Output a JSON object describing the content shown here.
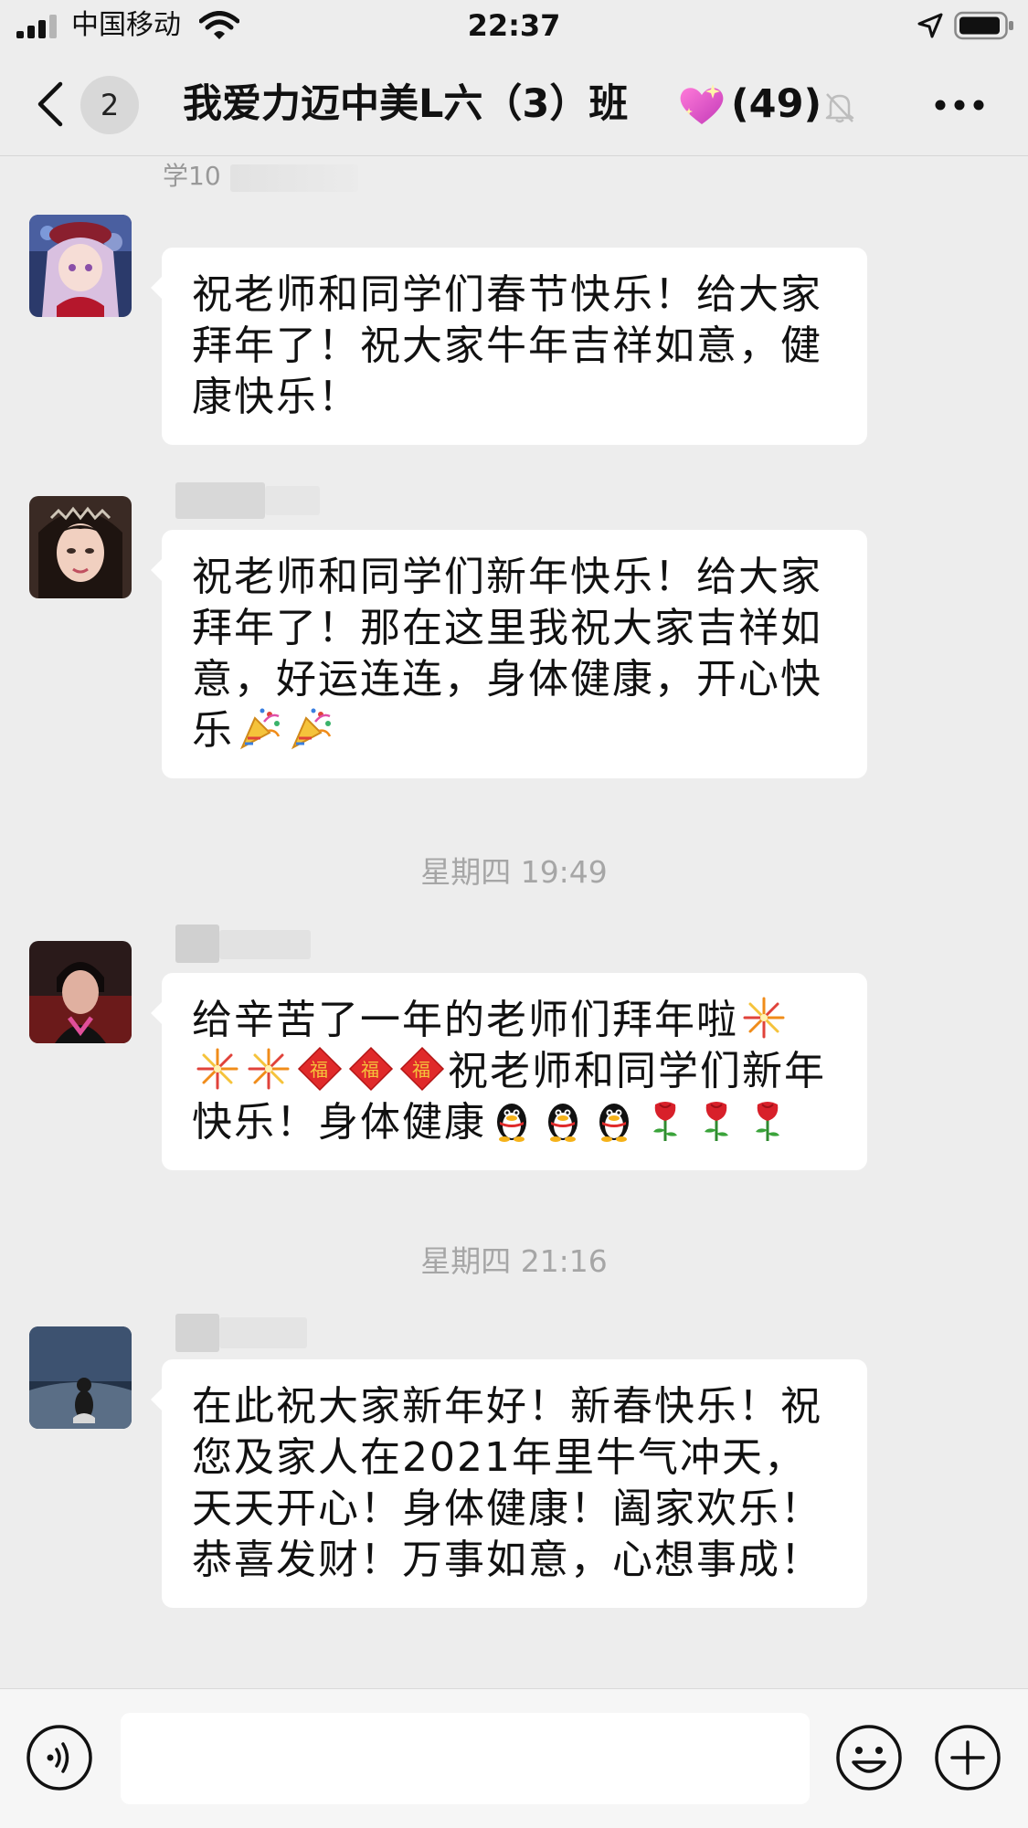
{
  "status_bar": {
    "carrier": "中国移动",
    "time": "22:37"
  },
  "nav": {
    "badge": "2",
    "title": "我爱力迈中美L六（3）班",
    "member_count": "(49)"
  },
  "messages": [
    {
      "sender": "学10",
      "text": "祝老师和同学们春节快乐！给大家拜年了！祝大家牛年吉祥如意，健康快乐！"
    },
    {
      "text": "祝老师和同学们新年快乐！给大家拜年了！那在这里我祝大家吉祥如意，好运连连，身体健康，开心快乐"
    },
    {
      "timestamp": "星期四 19:49",
      "text_a": "给辛苦了一年的老师们拜年啦",
      "text_b": "祝老师和同学们新年",
      "text_c": "快乐！身体健康"
    },
    {
      "timestamp": "星期四 21:16",
      "text": "在此祝大家新年好！新春快乐！祝您及家人在2021年里牛气冲天，天天开心！身体健康！阖家欢乐！恭喜发财！万事如意，心想事成！"
    }
  ],
  "icons": {
    "back": "chevron-left-icon",
    "heart": "sparkling-heart-icon",
    "mute": "bell-slash-icon",
    "more": "more-icon",
    "voice": "voice-icon",
    "emoji": "emoji-icon",
    "plus": "plus-icon",
    "party": "party-popper-icon",
    "fireworks": "fireworks-icon",
    "fu": "fu-charm-icon",
    "penguin": "penguin-icon",
    "rose": "rose-icon"
  },
  "colors": {
    "background": "#ededed",
    "bubble": "#ffffff",
    "timestamp": "#a6a6a6"
  }
}
